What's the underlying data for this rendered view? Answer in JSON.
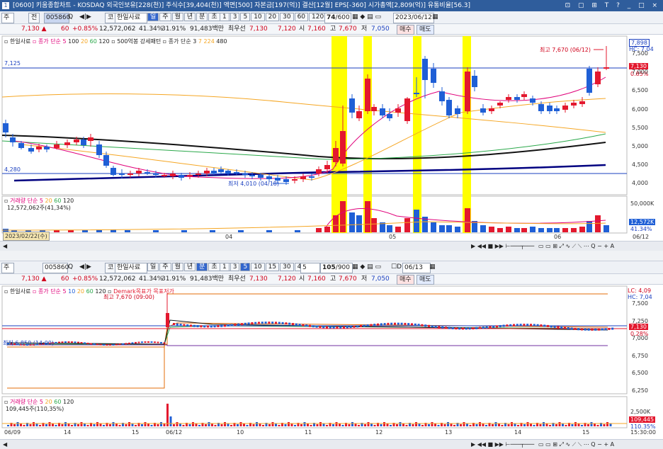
{
  "titlebar": {
    "number": "1",
    "text": "[0600] 키움종합차트 - KOSDAQ 외국인보유[228(천)] 주식수[39,404(천)] 액면[500] 자본금[197(억)] 결산[12월] EPS[-360] 시가총액[2,809(억)] 유통비율[56.3]",
    "buttons": "⊡ ▢ ⊞ T ? _ □ ×"
  },
  "top": {
    "toolbar": {
      "mode": "주",
      "code_btn": "전",
      "code": "005860",
      "search_icon": "Q",
      "arrows": "◀|▶",
      "name_btn": "코",
      "name": "한일사료",
      "periods": [
        "일",
        "주",
        "월",
        "년",
        "분",
        "초",
        "틱"
      ],
      "period_selected": "일",
      "minutes": [
        "1",
        "3",
        "5",
        "10",
        "20",
        "30",
        "60",
        "120"
      ],
      "count": "74",
      "count_total": "/600",
      "date": "2023/06/12"
    },
    "priceline": {
      "price": "7,130",
      "arrow": "▲",
      "diff": "60",
      "rate": "+0.85%",
      "volume": "12,572,062",
      "pct1": "41.34%",
      "pct2": "31.91%",
      "amount": "91,483백만",
      "label": "최우선",
      "ask": "7,130",
      "bid": "7,120",
      "open_lbl": "시",
      "open": "7,160",
      "high_lbl": "고",
      "high": "7,670",
      "low_lbl": "저",
      "low": "7,050",
      "buy": "매수",
      "sell": "매도"
    },
    "legend": {
      "name": "한일사료",
      "ma_label": "종가 단순",
      "ma": [
        "5",
        "100",
        "20",
        "60",
        "120"
      ],
      "pattern": "500억봉 강세패턴",
      "ma2_label": "종가 단순",
      "ma2": [
        "3",
        "7",
        "224",
        "480"
      ]
    },
    "high_note": "최고 7,670 (06/12)",
    "low_note": "최저 4,010 (04/18)",
    "left_lines": [
      "7,125",
      "4,280"
    ],
    "yticks": [
      "7,500",
      "7,000",
      "6,500",
      "6,000",
      "5,500",
      "5,000",
      "4,500",
      "4,000"
    ],
    "price_tags": {
      "hc": "HC: 7,04",
      "high": "7,898",
      "cur": "7,130",
      "rate": "0.85%"
    },
    "vol_legend": {
      "label": "거래량",
      "ma_label": "단순",
      "ma": [
        "5",
        "20",
        "60",
        "120"
      ],
      "value": "12,572,062주(41,34%)"
    },
    "vol_ticks": [
      "50,000K",
      "12,572K",
      "41.34%"
    ],
    "date_badge": "2023/02/22(수)",
    "xlabels": [
      "04",
      "05",
      "06",
      "06/12"
    ]
  },
  "bottom": {
    "toolbar": {
      "mode": "주",
      "code": "005860",
      "name_btn": "코",
      "name": "한일사료",
      "periods": [
        "일",
        "주",
        "월",
        "년",
        "분",
        "초",
        "틱"
      ],
      "period_selected": "분",
      "minutes": [
        "1",
        "3",
        "5",
        "10",
        "15",
        "30",
        "45",
        "60"
      ],
      "minute_selected": "5",
      "interval": "5",
      "count": "105",
      "count_total": "/900",
      "check_label": "D",
      "date": "06/13"
    },
    "priceline": {
      "price": "7,130",
      "arrow": "▲",
      "diff": "60",
      "rate": "+0.85%",
      "volume": "12,572,062",
      "pct1": "41.34%",
      "pct2": "31.91%",
      "amount": "91,483백만",
      "label": "최우선",
      "ask": "7,130",
      "bid": "7,120",
      "open_lbl": "시",
      "open": "7,160",
      "high_lbl": "고",
      "high": "7,670",
      "low_lbl": "저",
      "low": "7,050",
      "buy": "매수",
      "sell": "매도"
    },
    "legend": {
      "name": "한일사료",
      "ma_label": "종가 단순",
      "ma": [
        "5",
        "10",
        "20",
        "60",
        "120"
      ],
      "extra": "Demark목표가 목표저가"
    },
    "high_note": "최고 7,670 (09:00)",
    "low_note": "최저 6,850 (14:00)",
    "yticks": [
      "7,500",
      "7,250",
      "7,000",
      "6,750",
      "6,500",
      "6,250"
    ],
    "price_tags": {
      "lc": "LC: 4,09",
      "hc": "HC: 7,04",
      "cur": "7,130",
      "rate": "0.28%"
    },
    "vol_legend": {
      "label": "거래량",
      "ma_label": "단순",
      "ma": [
        "5",
        "20",
        "60",
        "120"
      ],
      "value": "109,445주(110,35%)"
    },
    "vol_ticks": [
      "2,500K",
      "109,445",
      "110.35%"
    ],
    "xlabels": [
      "06/09",
      "14",
      "15",
      "06/12",
      "10",
      "11",
      "12",
      "13",
      "14",
      "15",
      "15:30:00"
    ]
  },
  "colors": {
    "up": "#e3182e",
    "down": "#1f5fd6",
    "highlight": "#ffff00",
    "ma5": "#e0007a",
    "ma20": "#f5a623",
    "ma60": "#2aa84a",
    "ma120": "#111111"
  }
}
